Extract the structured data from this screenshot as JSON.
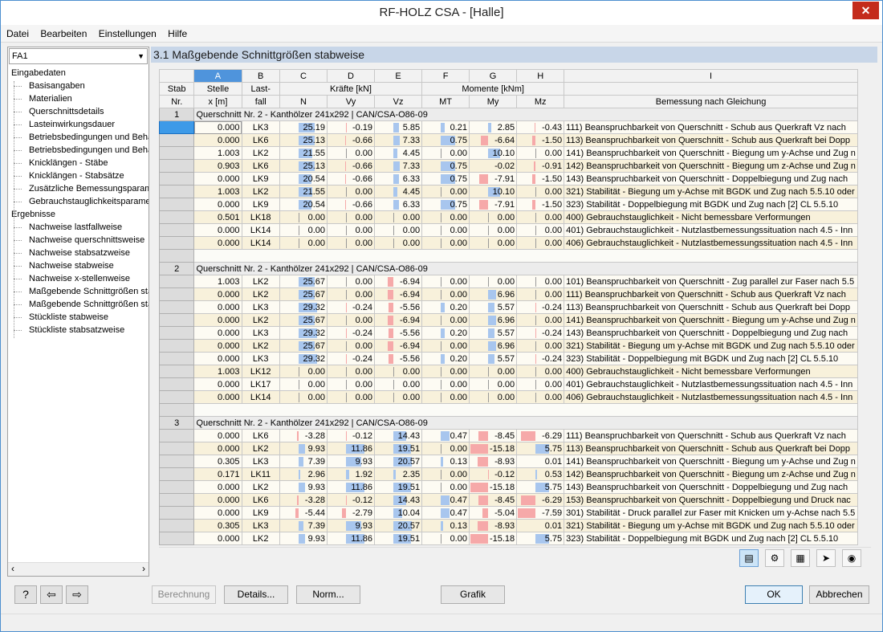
{
  "window": {
    "title": "RF-HOLZ CSA - [Halle]",
    "close_glyph": "✕"
  },
  "menu": [
    "Datei",
    "Bearbeiten",
    "Einstellungen",
    "Hilfe"
  ],
  "sidebar": {
    "selector": "FA1",
    "sections": [
      {
        "label": "Eingabedaten",
        "items": [
          "Basisangaben",
          "Materialien",
          "Querschnittsdetails",
          "Lasteinwirkungsdauer",
          "Betriebsbedingungen und Beha",
          "Betriebsbedingungen und Beha",
          "Knicklängen - Stäbe",
          "Knicklängen - Stabsätze",
          "Zusätzliche Bemessungsparame",
          "Gebrauchstauglichkeitsparamet"
        ]
      },
      {
        "label": "Ergebnisse",
        "items": [
          "Nachweise lastfallweise",
          "Nachweise querschnittsweise",
          "Nachweise stabsatzweise",
          "Nachweise stabweise",
          "Nachweise x-stellenweise",
          "Maßgebende Schnittgrößen sta",
          "Maßgebende Schnittgrößen sta",
          "Stückliste stabweise",
          "Stückliste stabsatzweise"
        ]
      }
    ]
  },
  "section_title": "3.1  Maßgebende Schnittgrößen stabweise",
  "table": {
    "col_letters": [
      "A",
      "B",
      "C",
      "D",
      "E",
      "F",
      "G",
      "H",
      "I"
    ],
    "header_top": {
      "stab": "Stab",
      "stelle": "Stelle",
      "last": "Last-",
      "kraefte": "Kräfte [kN]",
      "momente": "Momente [kNm]"
    },
    "header_bottom": {
      "nr": "Nr.",
      "x": "x [m]",
      "fall": "fall",
      "N": "N",
      "Vy": "Vy",
      "Vz": "Vz",
      "MT": "MT",
      "My": "My",
      "Mz": "Mz",
      "bem": "Bemessung nach Gleichung"
    },
    "groups": [
      {
        "nr": "1",
        "header": "Querschnitt Nr.  2 - Kanthölzer 241x292 | CAN/CSA-O86-09",
        "rows": [
          [
            "0.000",
            "LK3",
            "25.19",
            "-0.19",
            "5.85",
            "0.21",
            "2.85",
            "-0.43",
            "111) Beanspruchbarkeit von Querschnitt - Schub aus Querkraft Vz nach"
          ],
          [
            "0.000",
            "LK6",
            "25.13",
            "-0.66",
            "7.33",
            "0.75",
            "-6.64",
            "-1.50",
            "113) Beanspruchbarkeit von Querschnitt - Schub aus Querkraft bei Dopp"
          ],
          [
            "1.003",
            "LK2",
            "21.55",
            "0.00",
            "4.45",
            "0.00",
            "10.10",
            "0.00",
            "141) Beanspruchbarkeit von Querschnitt - Biegung um y-Achse und Zug n"
          ],
          [
            "0.903",
            "LK6",
            "25.13",
            "-0.66",
            "7.33",
            "0.75",
            "-0.02",
            "-0.91",
            "142) Beanspruchbarkeit von Querschnitt - Biegung um z-Achse und Zug n"
          ],
          [
            "0.000",
            "LK9",
            "20.54",
            "-0.66",
            "6.33",
            "0.75",
            "-7.91",
            "-1.50",
            "143) Beanspruchbarkeit von Querschnitt - Doppelbiegung und Zug nach"
          ],
          [
            "1.003",
            "LK2",
            "21.55",
            "0.00",
            "4.45",
            "0.00",
            "10.10",
            "0.00",
            "321) Stabilität - Biegung um y-Achse mit BGDK und Zug nach 5.5.10 oder"
          ],
          [
            "0.000",
            "LK9",
            "20.54",
            "-0.66",
            "6.33",
            "0.75",
            "-7.91",
            "-1.50",
            "323) Stabilität - Doppelbiegung mit BGDK und Zug nach [2] CL 5.5.10"
          ],
          [
            "0.501",
            "LK18",
            "0.00",
            "0.00",
            "0.00",
            "0.00",
            "0.00",
            "0.00",
            "400) Gebrauchstauglichkeit - Nicht bemessbare Verformungen"
          ],
          [
            "0.000",
            "LK14",
            "0.00",
            "0.00",
            "0.00",
            "0.00",
            "0.00",
            "0.00",
            "401) Gebrauchstauglichkeit - Nutzlastbemessungssituation nach 4.5 - Inn"
          ],
          [
            "0.000",
            "LK14",
            "0.00",
            "0.00",
            "0.00",
            "0.00",
            "0.00",
            "0.00",
            "406) Gebrauchstauglichkeit - Nutzlastbemessungssituation nach 4.5 - Inn"
          ]
        ]
      },
      {
        "nr": "2",
        "header": "Querschnitt Nr.  2 - Kanthölzer 241x292 | CAN/CSA-O86-09",
        "rows": [
          [
            "1.003",
            "LK2",
            "25.67",
            "0.00",
            "-6.94",
            "0.00",
            "0.00",
            "0.00",
            "101) Beanspruchbarkeit von Querschnitt - Zug parallel zur Faser nach 5.5"
          ],
          [
            "0.000",
            "LK2",
            "25.67",
            "0.00",
            "-6.94",
            "0.00",
            "6.96",
            "0.00",
            "111) Beanspruchbarkeit von Querschnitt - Schub aus Querkraft Vz nach"
          ],
          [
            "0.000",
            "LK3",
            "29.32",
            "-0.24",
            "-5.56",
            "0.20",
            "5.57",
            "-0.24",
            "113) Beanspruchbarkeit von Querschnitt - Schub aus Querkraft bei Dopp"
          ],
          [
            "0.000",
            "LK2",
            "25.67",
            "0.00",
            "-6.94",
            "0.00",
            "6.96",
            "0.00",
            "141) Beanspruchbarkeit von Querschnitt - Biegung um y-Achse und Zug n"
          ],
          [
            "0.000",
            "LK3",
            "29.32",
            "-0.24",
            "-5.56",
            "0.20",
            "5.57",
            "-0.24",
            "143) Beanspruchbarkeit von Querschnitt - Doppelbiegung und Zug nach"
          ],
          [
            "0.000",
            "LK2",
            "25.67",
            "0.00",
            "-6.94",
            "0.00",
            "6.96",
            "0.00",
            "321) Stabilität - Biegung um y-Achse mit BGDK und Zug nach 5.5.10 oder"
          ],
          [
            "0.000",
            "LK3",
            "29.32",
            "-0.24",
            "-5.56",
            "0.20",
            "5.57",
            "-0.24",
            "323) Stabilität - Doppelbiegung mit BGDK und Zug nach [2] CL 5.5.10"
          ],
          [
            "1.003",
            "LK12",
            "0.00",
            "0.00",
            "0.00",
            "0.00",
            "0.00",
            "0.00",
            "400) Gebrauchstauglichkeit - Nicht bemessbare Verformungen"
          ],
          [
            "0.000",
            "LK17",
            "0.00",
            "0.00",
            "0.00",
            "0.00",
            "0.00",
            "0.00",
            "401) Gebrauchstauglichkeit - Nutzlastbemessungssituation nach 4.5 - Inn"
          ],
          [
            "0.000",
            "LK14",
            "0.00",
            "0.00",
            "0.00",
            "0.00",
            "0.00",
            "0.00",
            "406) Gebrauchstauglichkeit - Nutzlastbemessungssituation nach 4.5 - Inn"
          ]
        ]
      },
      {
        "nr": "3",
        "header": "Querschnitt Nr.  2 - Kanthölzer 241x292 | CAN/CSA-O86-09",
        "rows": [
          [
            "0.000",
            "LK6",
            "-3.28",
            "-0.12",
            "14.43",
            "0.47",
            "-8.45",
            "-6.29",
            "111) Beanspruchbarkeit von Querschnitt - Schub aus Querkraft Vz nach"
          ],
          [
            "0.000",
            "LK2",
            "9.93",
            "11.86",
            "19.51",
            "0.00",
            "-15.18",
            "5.75",
            "113) Beanspruchbarkeit von Querschnitt - Schub aus Querkraft bei Dopp"
          ],
          [
            "0.305",
            "LK3",
            "7.39",
            "9.93",
            "20.57",
            "0.13",
            "-8.93",
            "0.01",
            "141) Beanspruchbarkeit von Querschnitt - Biegung um y-Achse und Zug n"
          ],
          [
            "0.171",
            "LK11",
            "2.96",
            "1.92",
            "2.35",
            "0.00",
            "-0.12",
            "0.53",
            "142) Beanspruchbarkeit von Querschnitt - Biegung um z-Achse und Zug n"
          ],
          [
            "0.000",
            "LK2",
            "9.93",
            "11.86",
            "19.51",
            "0.00",
            "-15.18",
            "5.75",
            "143) Beanspruchbarkeit von Querschnitt - Doppelbiegung und Zug nach"
          ],
          [
            "0.000",
            "LK6",
            "-3.28",
            "-0.12",
            "14.43",
            "0.47",
            "-8.45",
            "-6.29",
            "153) Beanspruchbarkeit von Querschnitt - Doppelbiegung und Druck nac"
          ],
          [
            "0.000",
            "LK9",
            "-5.44",
            "-2.79",
            "10.04",
            "0.47",
            "-5.04",
            "-7.59",
            "301) Stabilität - Druck parallel zur Faser mit Knicken um y-Achse nach 5.5"
          ],
          [
            "0.305",
            "LK3",
            "7.39",
            "9.93",
            "20.57",
            "0.13",
            "-8.93",
            "0.01",
            "321) Stabilität - Biegung um y-Achse mit BGDK und Zug nach 5.5.10 oder"
          ],
          [
            "0.000",
            "LK2",
            "9.93",
            "11.86",
            "19.51",
            "0.00",
            "-15.18",
            "5.75",
            "323) Stabilität - Doppelbiegung mit BGDK und Zug nach [2] CL 5.5.10"
          ]
        ]
      }
    ]
  },
  "toolbar_icons": [
    "table-settings-icon",
    "filter-icon",
    "excel-export-icon",
    "pointer-icon",
    "eye-icon"
  ],
  "buttons": {
    "berechnung": "Berechnung",
    "details": "Details...",
    "norm": "Norm...",
    "grafik": "Grafik",
    "ok": "OK",
    "abbrechen": "Abbrechen"
  },
  "colors": {
    "accent": "#4f94dc",
    "negative_bar": "#f6a9a9",
    "positive_bar": "#a8c6ee",
    "section_header": "#c8d6e8"
  }
}
